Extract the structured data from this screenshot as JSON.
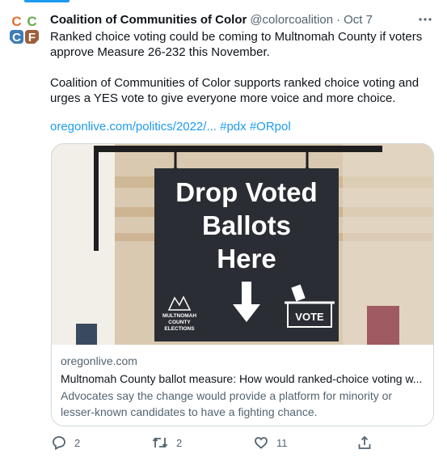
{
  "tweet": {
    "author_name": "Coalition of Communities of Color",
    "handle": "@colorcoalition",
    "separator": "·",
    "time": "Oct 7",
    "more_label": "···",
    "paragraph1": "Ranked choice voting could be coming to Multnomah County if voters approve Measure 26-232 this November.",
    "paragraph2": "Coalition of Communities of Color supports ranked choice voting and urges a YES vote to give everyone more voice and more choice.",
    "link": "oregonlive.com/politics/2022/...",
    "hashtags": [
      "#pdx",
      "#ORpol"
    ]
  },
  "avatar": {
    "letters": [
      "C",
      "C",
      "C",
      "F"
    ],
    "colors": [
      "#e0702c",
      "#6aa84f",
      "#3e7eb8",
      "#9c5f3a"
    ]
  },
  "card": {
    "domain": "oregonlive.com",
    "title": "Multnomah County ballot measure: How would ranked-choice voting w...",
    "description": "Advocates say the change would provide a platform for minority or lesser-known candidates to have a fighting chance.",
    "sign_lines": [
      "Drop Voted",
      "Ballots",
      "Here"
    ],
    "logo_lines": [
      "MULTNOMAH",
      "COUNTY",
      "ELECTIONS"
    ],
    "vote_label": "VOTE"
  },
  "actions": {
    "replies": "2",
    "retweets": "2",
    "likes": "11"
  },
  "colors": {
    "link": "#1d9bf0",
    "secondary_text": "#536471",
    "border": "#cfd9de"
  }
}
